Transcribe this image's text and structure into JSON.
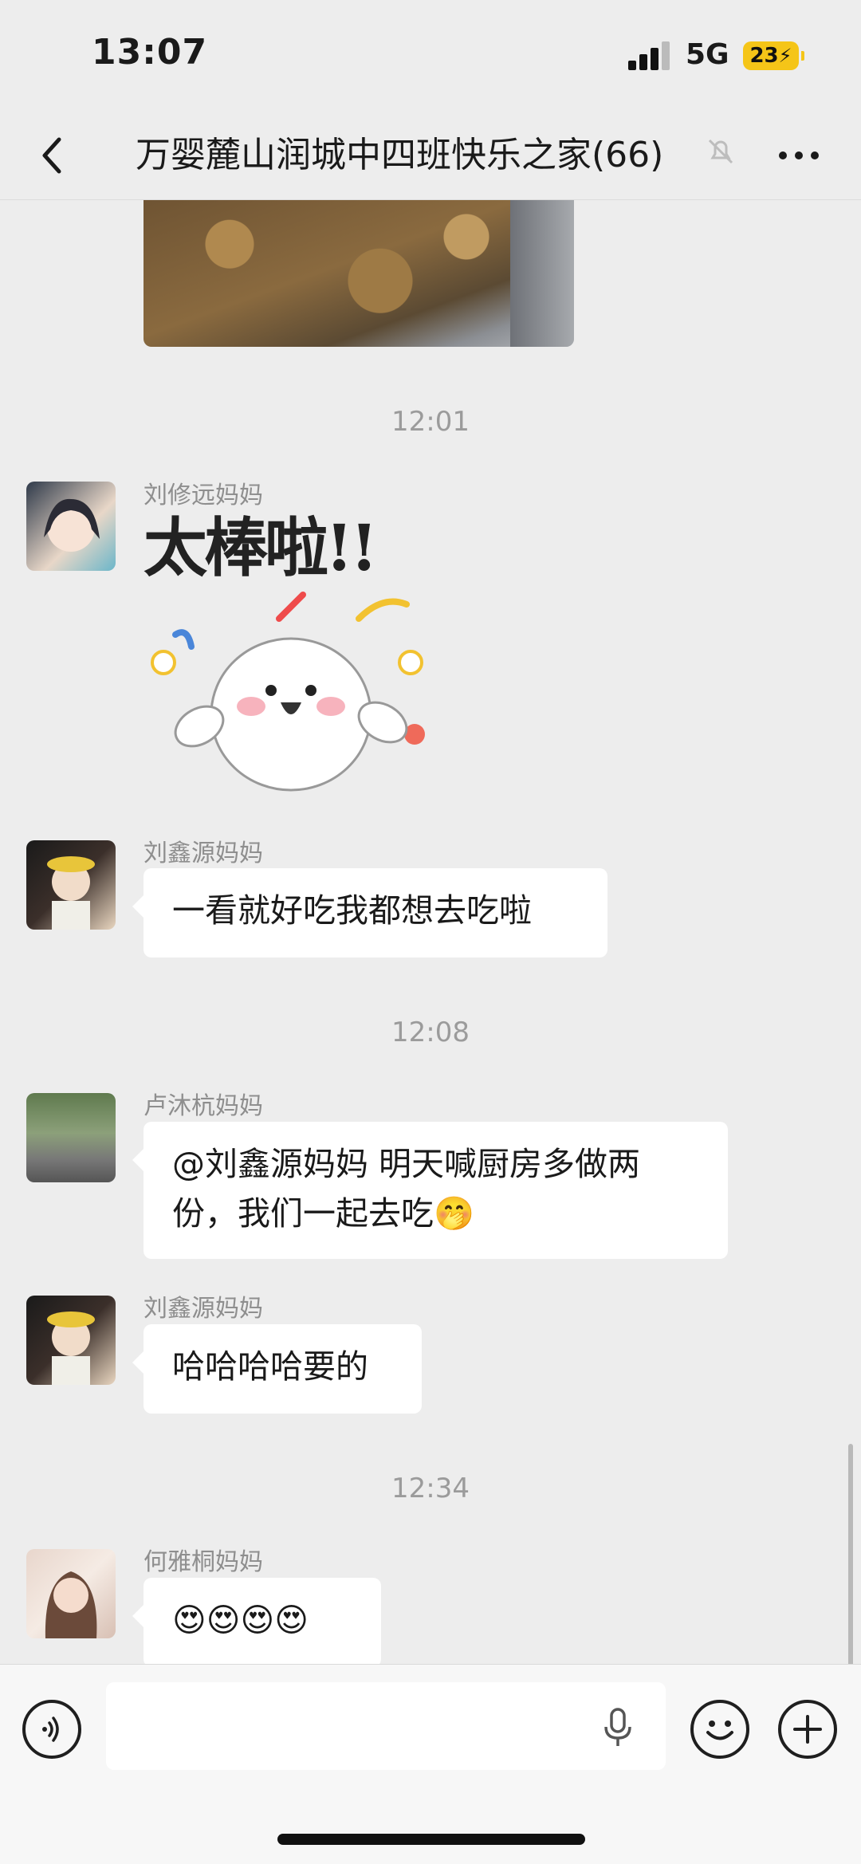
{
  "status_bar": {
    "time": "13:07",
    "network": "5G",
    "battery": "23"
  },
  "nav": {
    "title": "万婴麓山润城中四班快乐之家(66)"
  },
  "chat": {
    "messages": [
      {
        "type": "time",
        "text": "12:01"
      },
      {
        "type": "sticker",
        "sender": "刘修远妈妈",
        "sticker_text": "太棒啦!!"
      },
      {
        "type": "text",
        "sender": "刘鑫源妈妈",
        "text": "一看就好吃我都想去吃啦"
      },
      {
        "type": "time",
        "text": "12:08"
      },
      {
        "type": "text",
        "sender": "卢沐杭妈妈",
        "text": "@刘鑫源妈妈 明天喊厨房多做两份，我们一起去吃🤭"
      },
      {
        "type": "text",
        "sender": "刘鑫源妈妈",
        "text": "哈哈哈哈要的"
      },
      {
        "type": "time",
        "text": "12:34"
      },
      {
        "type": "text",
        "sender": "何雅桐妈妈",
        "text": "😍😍😍😍"
      }
    ]
  },
  "input": {
    "value": "",
    "placeholder": ""
  },
  "icons": [
    "back-icon",
    "mute-bell-icon",
    "more-icon",
    "voice-icon",
    "mic-icon",
    "emoji-icon",
    "plus-icon"
  ]
}
